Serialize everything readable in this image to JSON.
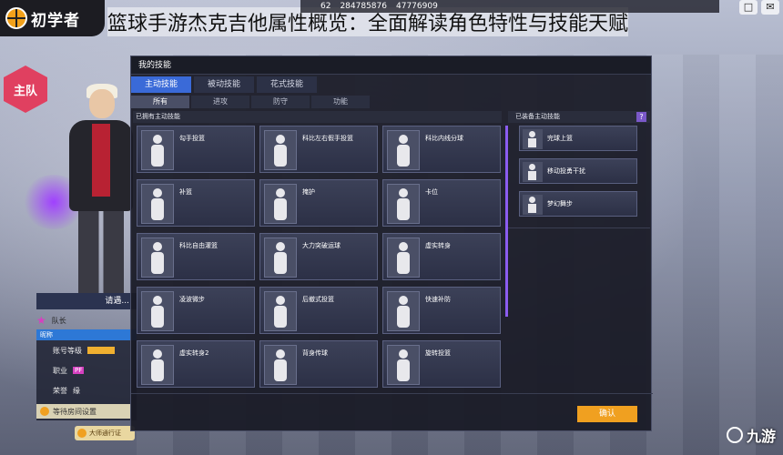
{
  "header": {
    "logo_text": "初学者",
    "page_title": "篮球手游杰克吉他属性概览：全面解读角色特性与技能天赋",
    "top_stats": [
      "62",
      "284785876",
      "47776909"
    ],
    "corner_left": "□",
    "corner_right": "✉"
  },
  "left": {
    "team_badge": "主队",
    "greet": "请遇...",
    "tag_label": "队长",
    "info_header": "昵称",
    "rows": [
      {
        "label": "账号等级",
        "value": ""
      },
      {
        "label": "职业",
        "value": "PF"
      },
      {
        "label": "荣誉",
        "value": "缘"
      }
    ],
    "room_btn": "等待房间设置",
    "pass_btn": "大师通行证"
  },
  "window": {
    "title": "我的技能",
    "tabs": [
      "主动技能",
      "被动技能",
      "花式技能"
    ],
    "active_tab": 0,
    "subtabs": [
      "所有",
      "进攻",
      "防守",
      "功能"
    ],
    "active_subtab": 0,
    "owned_header": "已拥有主动技能",
    "equipped_header": "已装备主动技能",
    "help": "?",
    "skills": [
      "勾手投篮",
      "科比左右假手投篮",
      "科比内线分球",
      "补篮",
      "掩护",
      "卡位",
      "科比自由灌篮",
      "大力突破运球",
      "虚实转身",
      "凌波微步",
      "后撤式投篮",
      "快速补防",
      "虚实转身2",
      "背身传球",
      "旋转投篮"
    ],
    "equipped": [
      "完球上篮",
      "移动投勇干扰",
      "梦幻舞步"
    ],
    "confirm": "确认"
  },
  "watermark": "九游"
}
